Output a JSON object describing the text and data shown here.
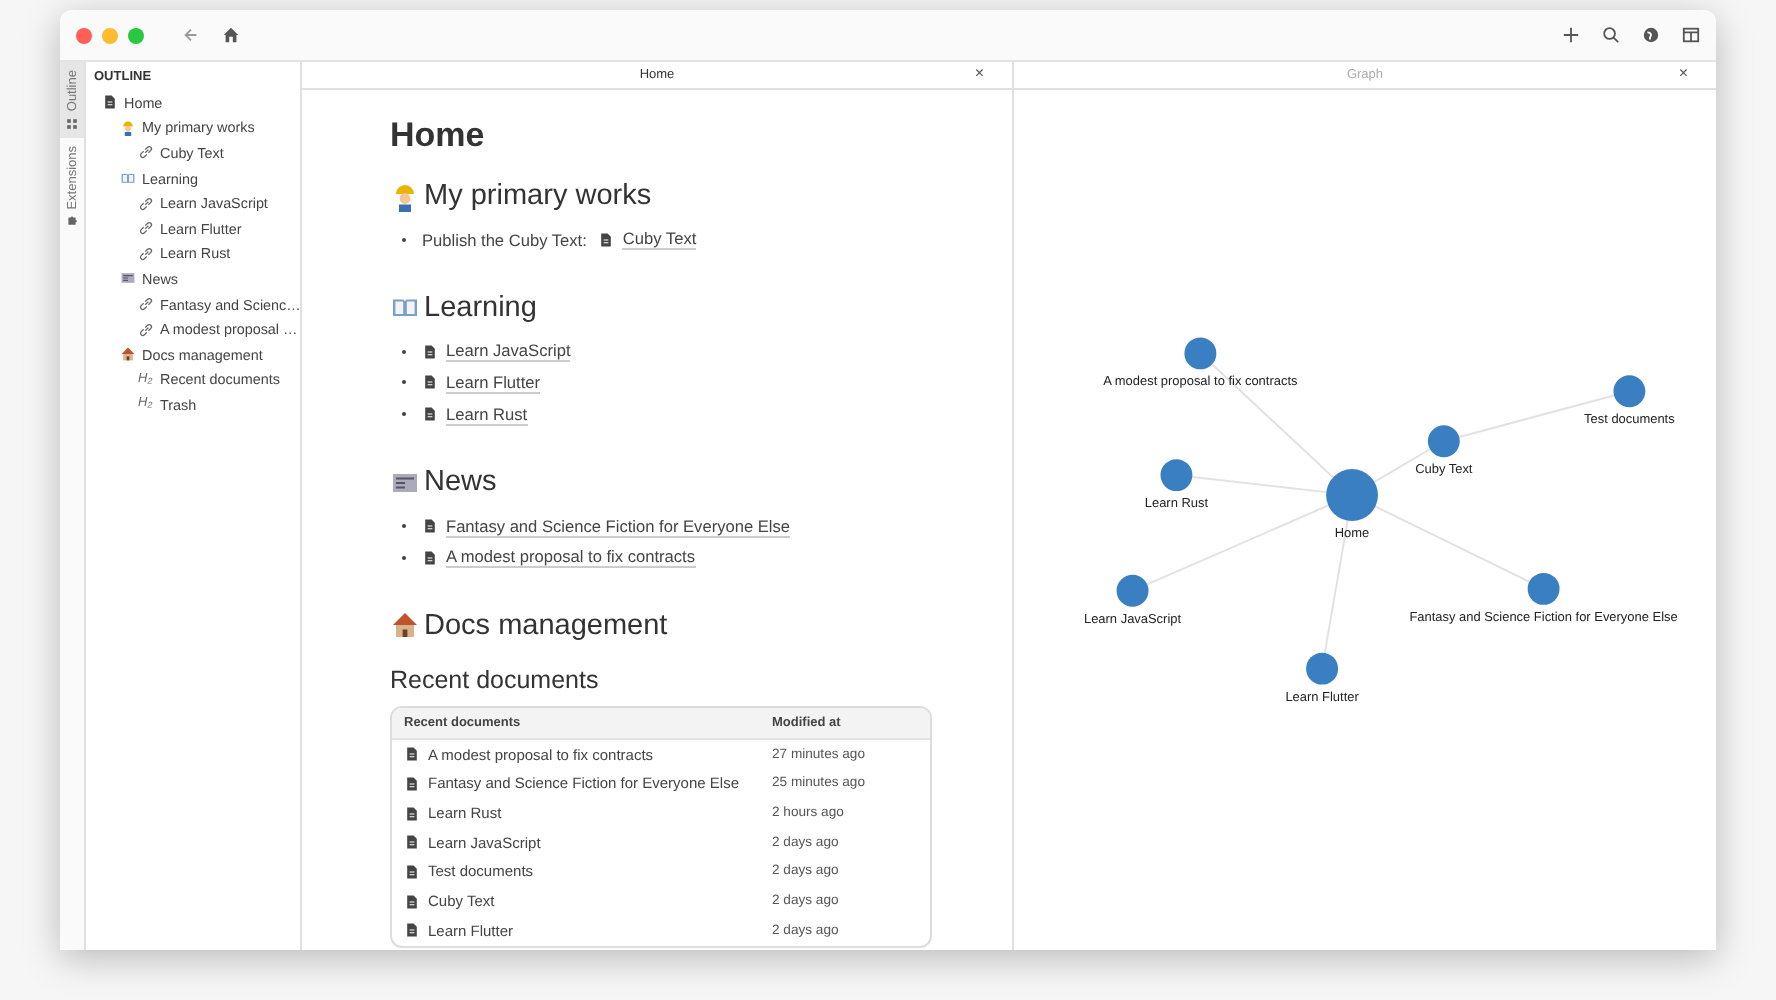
{
  "sidebar_tabs": [
    {
      "label": "Outline",
      "kind": "outline",
      "selected": true
    },
    {
      "label": "Extensions",
      "kind": "extensions",
      "selected": false
    }
  ],
  "outline": {
    "title": "OUTLINE",
    "items": [
      {
        "label": "Home",
        "kind": "doc",
        "children": [
          {
            "label": "My primary works",
            "kind": "worker",
            "children": [
              {
                "label": "Cuby Text",
                "kind": "link"
              }
            ]
          },
          {
            "label": "Learning",
            "kind": "book",
            "children": [
              {
                "label": "Learn JavaScript",
                "kind": "link"
              },
              {
                "label": "Learn Flutter",
                "kind": "link"
              },
              {
                "label": "Learn Rust",
                "kind": "link"
              }
            ]
          },
          {
            "label": "News",
            "kind": "newspaper",
            "children": [
              {
                "label": "Fantasy and Scienc…",
                "kind": "link"
              },
              {
                "label": "A modest proposal …",
                "kind": "link"
              }
            ]
          },
          {
            "label": "Docs management",
            "kind": "house",
            "children": [
              {
                "label": "Recent documents",
                "kind": "heading",
                "marker": "H₂"
              },
              {
                "label": "Trash",
                "kind": "heading",
                "marker": "H₂"
              }
            ]
          }
        ]
      }
    ]
  },
  "editor": {
    "tab": {
      "title": "Home",
      "close": "×"
    },
    "title": "Home",
    "sections": [
      {
        "kind": "worker",
        "heading": "My primary works",
        "items": [
          {
            "text": "Publish the Cuby Text:",
            "link": "Cuby Text"
          }
        ]
      },
      {
        "kind": "book",
        "heading": "Learning",
        "items": [
          {
            "link": "Learn JavaScript"
          },
          {
            "link": "Learn Flutter"
          },
          {
            "link": "Learn Rust"
          }
        ]
      },
      {
        "kind": "newspaper",
        "heading": "News",
        "items": [
          {
            "link": "Fantasy and Science Fiction for Everyone Else"
          },
          {
            "link": "A modest proposal to fix contracts"
          }
        ]
      },
      {
        "kind": "house",
        "heading": "Docs management"
      }
    ],
    "subheading": "Recent documents",
    "table": {
      "columns": [
        "Recent documents",
        "Modified at"
      ],
      "rows": [
        [
          "A modest proposal to fix contracts",
          "27 minutes ago"
        ],
        [
          "Fantasy and Science Fiction for Everyone Else",
          "25 minutes ago"
        ],
        [
          "Learn Rust",
          "2 hours ago"
        ],
        [
          "Learn JavaScript",
          "2 days ago"
        ],
        [
          "Test documents",
          "2 days ago"
        ],
        [
          "Cuby Text",
          "2 days ago"
        ],
        [
          "Learn Flutter",
          "2 days ago"
        ]
      ]
    }
  },
  "graph": {
    "tab": {
      "title": "Graph",
      "close": "×"
    },
    "nodes": [
      {
        "label": "Home",
        "children": [
          {
            "label": "A modest proposal to fix contracts"
          },
          {
            "label": "Cuby Text",
            "children": [
              {
                "label": "Test documents"
              }
            ]
          },
          {
            "label": "Learn Rust"
          },
          {
            "label": "Learn JavaScript"
          },
          {
            "label": "Fantasy and Science Fiction for Everyone Else"
          },
          {
            "label": "Learn Flutter"
          }
        ]
      }
    ]
  }
}
